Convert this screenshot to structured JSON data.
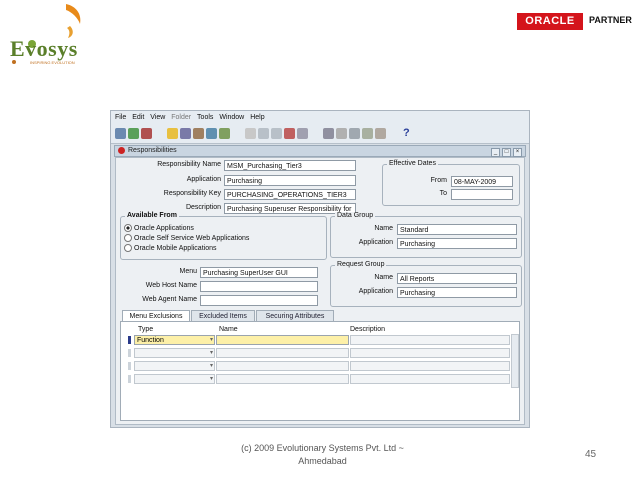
{
  "header": {
    "logo_text": "Evosys",
    "logo_subtext": "INSPIRING EVOLUTION",
    "oracle_label": "ORACLE",
    "partner_label": "PARTNER"
  },
  "menu": {
    "items": [
      "File",
      "Edit",
      "View",
      "Folder",
      "Tools",
      "Window",
      "Help"
    ]
  },
  "toolbar": {
    "help_label": "?"
  },
  "window": {
    "title": "Responsibilities",
    "controls": [
      "_",
      "□",
      "×"
    ]
  },
  "form": {
    "responsibility_name": {
      "label": "Responsibility Name",
      "value": "MSM_Purchasing_Tier3"
    },
    "application": {
      "label": "Application",
      "value": "Purchasing"
    },
    "responsibility_key": {
      "label": "Responsibility Key",
      "value": "PURCHASING_OPERATIONS_TIER3"
    },
    "description": {
      "label": "Description",
      "value": "Purchasing Superuser Responsibility for"
    },
    "effective_dates": {
      "title": "Effective Dates",
      "from_label": "From",
      "from_value": "08-MAY-2009",
      "to_label": "To",
      "to_value": ""
    },
    "available_from": {
      "title": "Available From",
      "options": [
        "Oracle Applications",
        "Oracle Self Service Web Applications",
        "Oracle Mobile Applications"
      ],
      "selected": "Oracle Applications"
    },
    "data_group": {
      "title": "Data Group",
      "name_label": "Name",
      "name_value": "Standard",
      "application_label": "Application",
      "application_value": "Purchasing"
    },
    "menu_field": {
      "label": "Menu",
      "value": "Purchasing SuperUser GUI"
    },
    "web_host_name": {
      "label": "Web Host Name",
      "value": ""
    },
    "web_agent_name": {
      "label": "Web Agent Name",
      "value": ""
    },
    "request_group": {
      "title": "Request Group",
      "name_label": "Name",
      "name_value": "All Reports",
      "application_label": "Application",
      "application_value": "Purchasing"
    }
  },
  "tabs": [
    {
      "label": "Menu Exclusions",
      "active": true
    },
    {
      "label": "Excluded Items",
      "active": false
    },
    {
      "label": "Securing Attributes",
      "active": false
    }
  ],
  "table": {
    "columns": [
      "Type",
      "Name",
      "Description"
    ],
    "rows": [
      {
        "type": "Function",
        "name": "",
        "description": ""
      },
      {
        "type": "",
        "name": "",
        "description": ""
      },
      {
        "type": "",
        "name": "",
        "description": ""
      },
      {
        "type": "",
        "name": "",
        "description": ""
      }
    ]
  },
  "footer": {
    "copyright_line1": "(c) 2009 Evolutionary Systems Pvt. Ltd ~",
    "copyright_line2": "Ahmedabad",
    "page_number": "45"
  },
  "colors": {
    "oracle_red": "#d4141b",
    "current_field": "#fdf0a8",
    "frame_bg": "#d8dfe6"
  }
}
